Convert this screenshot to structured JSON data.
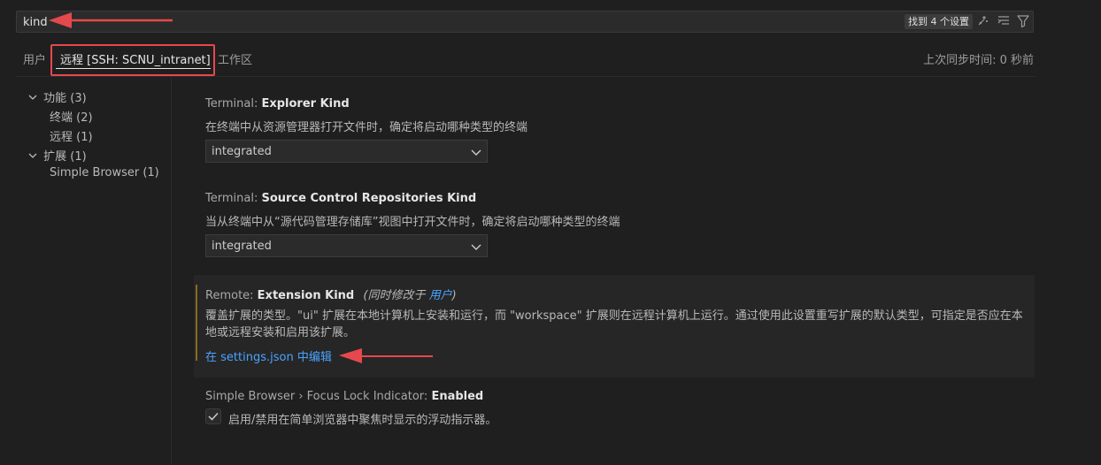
{
  "search": {
    "value": "kind",
    "results_badge": "找到 4 个设置"
  },
  "tabs": [
    {
      "label": "用户"
    },
    {
      "label": "远程 [SSH: SCNU_intranet]"
    },
    {
      "label": "工作区"
    }
  ],
  "sync_time": "上次同步时间: 0 秒前",
  "tree": [
    {
      "label": "功能 (3)"
    },
    {
      "label": "终端 (2)"
    },
    {
      "label": "远程 (1)"
    },
    {
      "label": "扩展 (1)"
    },
    {
      "label": "Simple Browser (1)"
    }
  ],
  "settings": {
    "s1": {
      "prefix": "Terminal: ",
      "name": "Explorer Kind",
      "desc": "在终端中从资源管理器打开文件时，确定将启动哪种类型的终端",
      "value": "integrated"
    },
    "s2": {
      "prefix": "Terminal: ",
      "name": "Source Control Repositories Kind",
      "desc": "当从终端中从“源代码管理存储库”视图中打开文件时，确定将启动哪种类型的终端",
      "value": "integrated"
    },
    "s3": {
      "prefix": "Remote: ",
      "name": "Extension Kind",
      "modified_prefix": "(同时修改于 ",
      "modified_link": "用户",
      "modified_suffix": ")",
      "desc_line1": "覆盖扩展的类型。\"ui\" 扩展在本地计算机上安装和运行，而 \"workspace\" 扩展则在远程计算机上运行。通过使用此设置重写扩展的默认类型，可指定是否应在本",
      "desc_line2": "地或远程安装和启用该扩展。",
      "edit_link": "在 settings.json 中编辑"
    },
    "s4": {
      "prefix": "Simple Browser › Focus Lock Indicator: ",
      "name": "Enabled",
      "desc": "启用/禁用在简单浏览器中聚焦时显示的浮动指示器。",
      "checked": true
    }
  },
  "colors": {
    "background": "#1f1f1f",
    "link": "#4aa3ff",
    "annotation_red": "#e5484d"
  }
}
